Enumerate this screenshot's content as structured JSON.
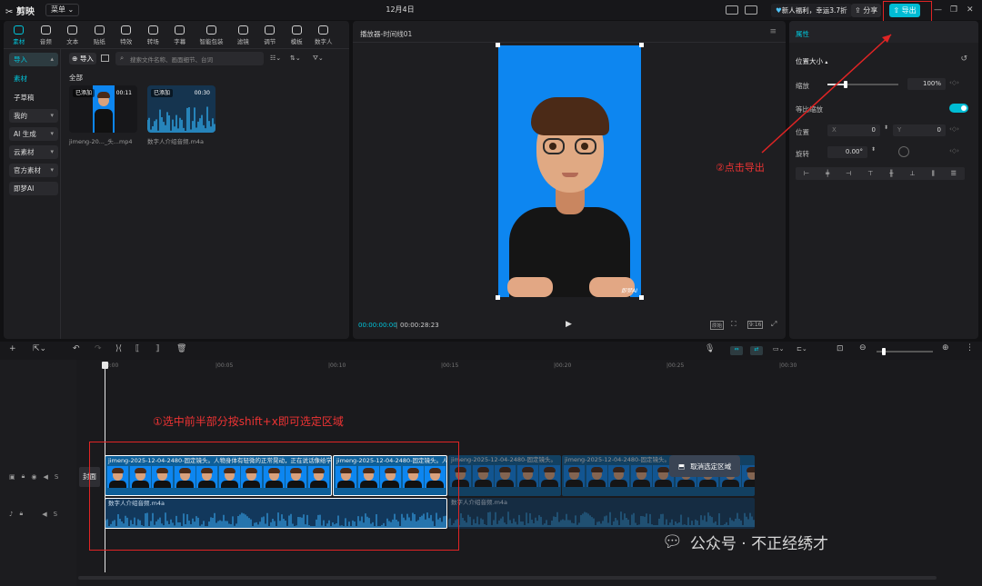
{
  "titlebar": {
    "app_name": "剪映",
    "menu_label": "菜单",
    "date": "12月4日",
    "vip_text": "新人福利，幸运3.7折",
    "share_label": "分享",
    "export_label": "导出"
  },
  "media_tabs": [
    "素材",
    "音频",
    "文本",
    "贴纸",
    "特效",
    "转场",
    "字幕",
    "智能包装",
    "滤镜",
    "调节",
    "模板",
    "数字人"
  ],
  "sidebar": {
    "items": [
      {
        "label": "导入",
        "active": true
      },
      {
        "label": "素材",
        "active": false
      },
      {
        "label": "子草稿",
        "active": false
      },
      {
        "label": "我的",
        "active": false
      },
      {
        "label": "AI 生成",
        "active": false
      },
      {
        "label": "云素材",
        "active": false
      },
      {
        "label": "官方素材",
        "active": false
      },
      {
        "label": "即梦AI",
        "active": false
      }
    ]
  },
  "media": {
    "import_label": "导入",
    "search_placeholder": "搜索文件名称、画面细节、台词",
    "all_label": "全部",
    "items": [
      {
        "badge": "已添加",
        "duration": "00:11",
        "name": "jimeng-20..._头...mp4"
      },
      {
        "badge": "已添加",
        "duration": "00:30",
        "name": "数字人介绍音频.m4a"
      }
    ]
  },
  "player": {
    "title": "播放器-时间线01",
    "current_time": "00:00:00:00",
    "total_time": "00:00:28:23",
    "aspect": "9:16",
    "btn_full": "原始",
    "watermark": "即梦AI"
  },
  "properties": {
    "tab": "属性",
    "section": "位置大小",
    "scale_label": "缩放",
    "scale_value": "100%",
    "scale_level": 0.25,
    "uniform_label": "等比缩放",
    "position_label": "位置",
    "x_label": "X",
    "x_value": "0",
    "y_label": "Y",
    "y_value": "0",
    "rotate_label": "旋转",
    "rotate_value": "0.00°"
  },
  "timeline": {
    "ruler": [
      "00:00",
      "|00:05",
      "|00:10",
      "|00:15",
      "|00:20",
      "|00:25",
      "|00:30"
    ],
    "cover_label": "封面",
    "video_clip_label": "jimeng-2025-12-04-2480-固定镜头。人物身体有轻微的正常晃动，正在说话像给学生",
    "video_clip2_label": "jimeng-2025-12-04-2480-固定镜头。人物",
    "video_clip3_label": "jimeng-2025-12-04-2480-固定镜头。",
    "video_clip4_label": "jimeng-2025-12-04-2480-固定镜头。人",
    "audio_clip_label": "数字人介绍音频.m4a",
    "audio_clip2_label": "数字人介绍音频.m4a",
    "deselect_label": "取消选定区域"
  },
  "annotations": {
    "step1": "①选中前半部分按shift+x即可选定区域",
    "step2": "②点击导出"
  },
  "watermark_text": "公众号 · 不正经绣才",
  "colors": {
    "accent": "#00bcd4",
    "annotation": "#e02424",
    "video_blue": "#0d86f0"
  }
}
